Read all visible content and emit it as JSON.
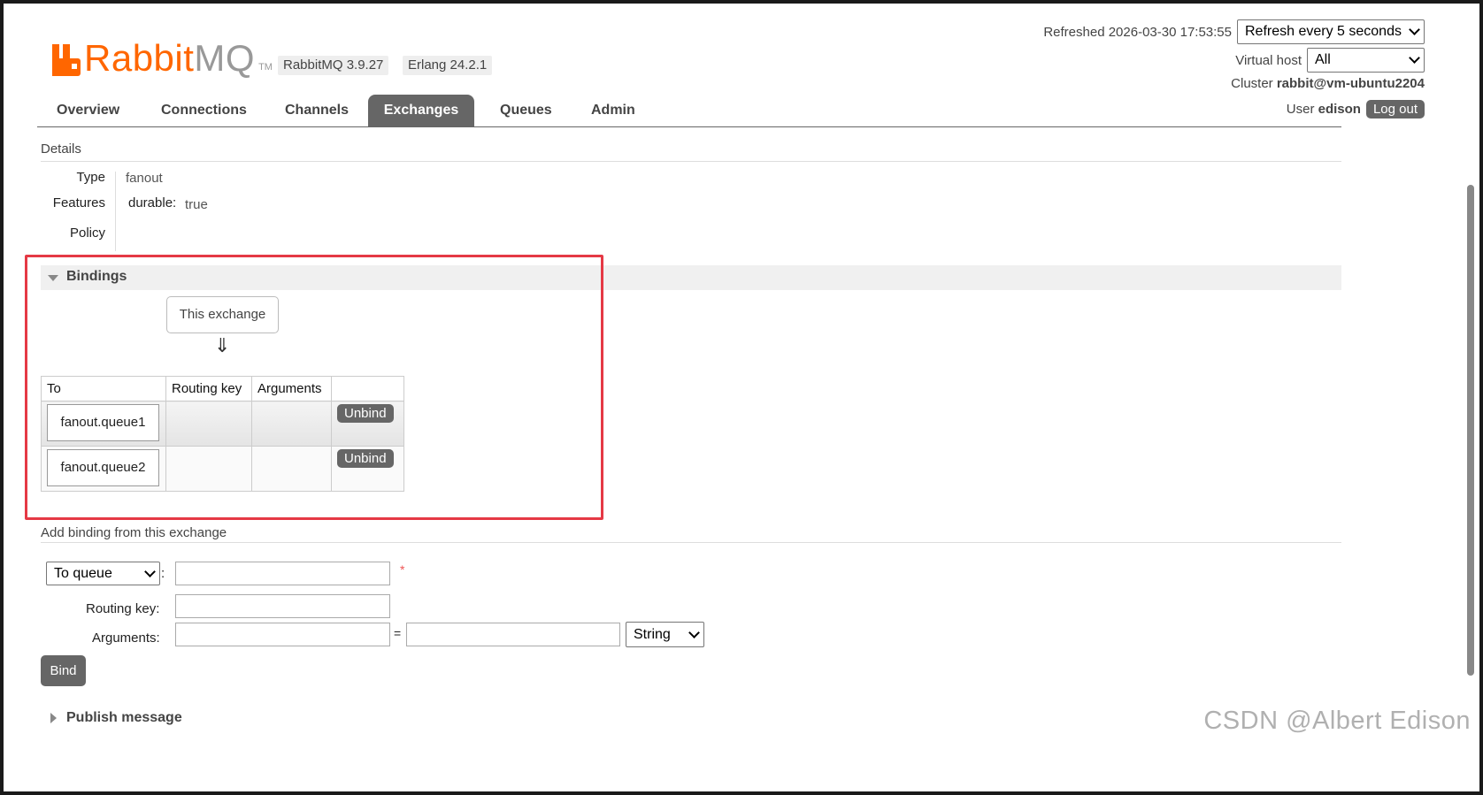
{
  "brand": {
    "rabbit": "Rabbit",
    "mq": "MQ",
    "tm": "TM"
  },
  "versions": {
    "rabbitmq": "RabbitMQ 3.9.27",
    "erlang": "Erlang 24.2.1"
  },
  "topright": {
    "refreshed_label": "Refreshed 2026-03-30 17:53:55",
    "refresh_select": "Refresh every 5 seconds",
    "vhost_label": "Virtual host",
    "vhost_select": "All",
    "cluster_label": "Cluster",
    "cluster_value": "rabbit@vm-ubuntu2204",
    "user_label": "User",
    "user_value": "edison",
    "logout": "Log out"
  },
  "nav": {
    "items": [
      "Overview",
      "Connections",
      "Channels",
      "Exchanges",
      "Queues",
      "Admin"
    ],
    "active": "Exchanges"
  },
  "details": {
    "title": "Details",
    "type_label": "Type",
    "type_value": "fanout",
    "features_label": "Features",
    "features_key": "durable:",
    "features_value": "true",
    "policy_label": "Policy"
  },
  "bindings": {
    "title": "Bindings",
    "this_exchange": "This exchange",
    "arrow": "⇓",
    "columns": [
      "To",
      "Routing key",
      "Arguments",
      ""
    ],
    "rows": [
      {
        "to": "fanout.queue1",
        "routing_key": "",
        "arguments": "",
        "action": "Unbind"
      },
      {
        "to": "fanout.queue2",
        "routing_key": "",
        "arguments": "",
        "action": "Unbind"
      }
    ]
  },
  "add_binding": {
    "title": "Add binding from this exchange",
    "dest_select": "To queue",
    "colon": ":",
    "required": "*",
    "routing_key_label": "Routing key:",
    "arguments_label": "Arguments:",
    "equals": "=",
    "type_select": "String",
    "bind_button": "Bind"
  },
  "publish": {
    "title": "Publish message"
  },
  "watermark": "CSDN @Albert Edison",
  "colors": {
    "brand": "#ff6600",
    "highlight": "#e53945",
    "nav_active": "#666666"
  }
}
